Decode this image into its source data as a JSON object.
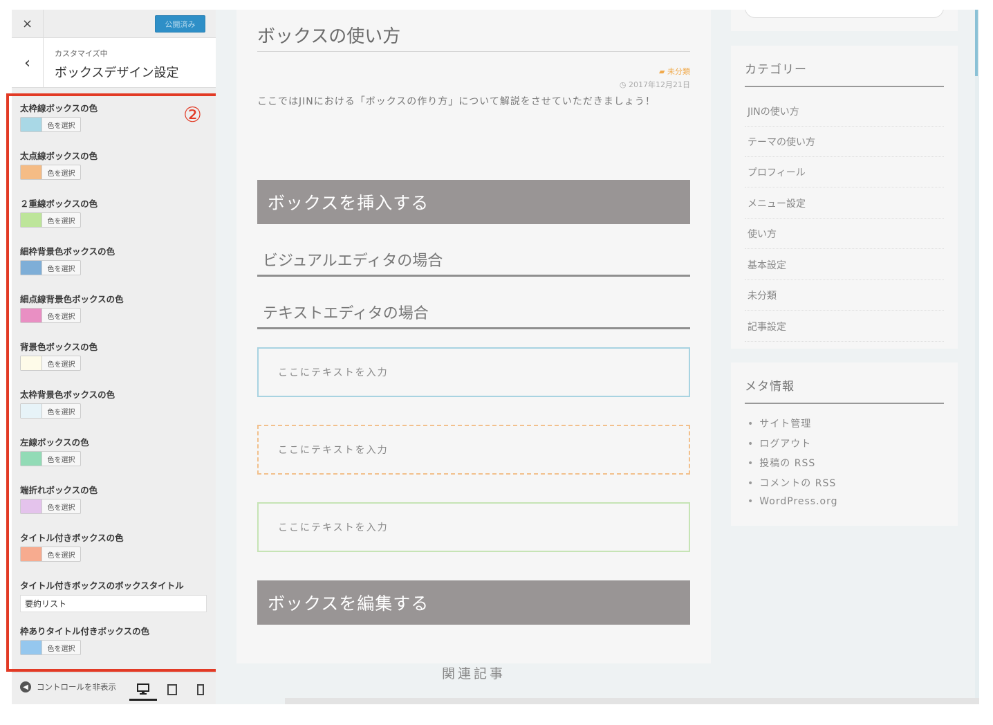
{
  "panel": {
    "close_label": "×",
    "publish_label": "公開済み",
    "back_label": "‹",
    "customizing_label": "カスタマイズ中",
    "section_title": "ボックスデザイン設定",
    "select_color_label": "色を選択",
    "controls": [
      {
        "label": "太枠線ボックスの色",
        "color": "#a9d8e6"
      },
      {
        "label": "太点線ボックスの色",
        "color": "#f5bc85"
      },
      {
        "label": "２重線ボックスの色",
        "color": "#bde59a"
      },
      {
        "label": "細枠背景色ボックスの色",
        "color": "#7eaed7"
      },
      {
        "label": "細点線背景色ボックスの色",
        "color": "#e98fc3"
      },
      {
        "label": "背景色ボックスの色",
        "color": "#fefbe9"
      },
      {
        "label": "太枠背景色ボックスの色",
        "color": "#e7f3f8"
      },
      {
        "label": "左線ボックスの色",
        "color": "#92dbb6"
      },
      {
        "label": "端折れボックスの色",
        "color": "#e4c3ec"
      },
      {
        "label": "タイトル付きボックスの色",
        "color": "#f7ab8f"
      }
    ],
    "title_box_title_label": "タイトル付きボックスのボックスタイトル",
    "title_box_title_value": "要約リスト",
    "framed_title_box_label": "枠ありタイトル付きボックスの色",
    "framed_title_box_color": "#95c7ee",
    "hide_controls_label": "コントロールを非表示",
    "annotation_marker": "②"
  },
  "preview": {
    "breadcrumb": "",
    "post_title": "ボックスの使い方",
    "category": "未分類",
    "date": "2017年12月21日",
    "intro": "ここではJINにおける「ボックスの作り方」について解説をさせていただきましょう！",
    "heading_insert": "ボックスを挿入する",
    "sub_visual": "ビジュアルエディタの場合",
    "sub_text": "テキストエディタの場合",
    "box_placeholder": "ここにテキストを入力",
    "heading_edit": "ボックスを編集する",
    "related": "関連記事",
    "sidebar": {
      "category_title": "カテゴリー",
      "categories": [
        "JINの使い方",
        "テーマの使い方",
        "プロフィール",
        "メニュー設定",
        "使い方",
        "基本設定",
        "未分類",
        "記事設定"
      ],
      "meta_title": "メタ情報",
      "meta_links": [
        "サイト管理",
        "ログアウト",
        "投稿の RSS",
        "コメントの RSS",
        "WordPress.org"
      ]
    }
  },
  "colors": {
    "publish": "#2e8fc7",
    "annotation": "#e23a25",
    "heading_bar": "#999595"
  }
}
